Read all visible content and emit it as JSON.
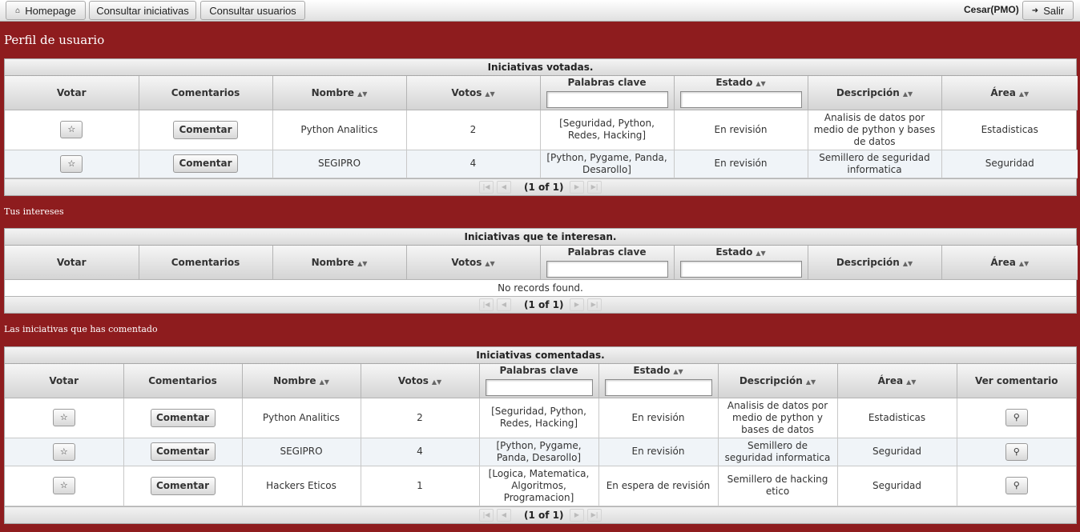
{
  "nav": {
    "homepage": "Homepage",
    "consultar_iniciativas": "Consultar iniciativas",
    "consultar_usuarios": "Consultar usuarios",
    "user": "Cesar(PMO)",
    "salir": "Salir",
    "home_icon": "home-icon",
    "exit_icon": "exit-icon"
  },
  "page": {
    "title": "Perfil de usuario",
    "section2": "Tus intereses",
    "section3": "Las iniciativas que has comentado"
  },
  "columns": {
    "votar": "Votar",
    "comentarios": "Comentarios",
    "nombre": "Nombre",
    "votos": "Votos",
    "palabras": "Palabras clave",
    "estado": "Estado",
    "descripcion": "Descripción",
    "area": "Área",
    "ver": "Ver comentario"
  },
  "buttons": {
    "comentar": "Comentar",
    "vote_icon": "star-icon",
    "view_icon": "magnifier-icon"
  },
  "voted": {
    "title": "Iniciativas votadas.",
    "rows": [
      {
        "nombre": "Python Analitics",
        "votos": "2",
        "palabras": "[Seguridad, Python, Redes, Hacking]",
        "estado": "En revisión",
        "descripcion": "Analisis de datos por medio de python y bases de datos",
        "area": "Estadisticas"
      },
      {
        "nombre": "SEGIPRO",
        "votos": "4",
        "palabras": "[Python, Pygame, Panda, Desarollo]",
        "estado": "En revisión",
        "descripcion": "Semillero de seguridad informatica",
        "area": "Seguridad"
      }
    ],
    "pager": "(1 of 1)"
  },
  "interests": {
    "title": "Iniciativas que te interesan.",
    "empty": "No records found.",
    "pager": "(1 of 1)"
  },
  "commented": {
    "title": "Iniciativas comentadas.",
    "rows": [
      {
        "nombre": "Python Analitics",
        "votos": "2",
        "palabras": "[Seguridad, Python, Redes, Hacking]",
        "estado": "En revisión",
        "descripcion": "Analisis de datos por medio de python y bases de datos",
        "area": "Estadisticas"
      },
      {
        "nombre": "SEGIPRO",
        "votos": "4",
        "palabras": "[Python, Pygame, Panda, Desarollo]",
        "estado": "En revisión",
        "descripcion": "Semillero de seguridad informatica",
        "area": "Seguridad"
      },
      {
        "nombre": "Hackers Eticos",
        "votos": "1",
        "palabras": "[Logica, Matematica, Algoritmos, Programacion]",
        "estado": "En espera de revisión",
        "descripcion": "Semillero de hacking etico",
        "area": "Seguridad"
      }
    ],
    "pager": "(1 of 1)"
  },
  "colors": {
    "background": "#8e1c1e",
    "row_alt": "#f0f4f8"
  }
}
